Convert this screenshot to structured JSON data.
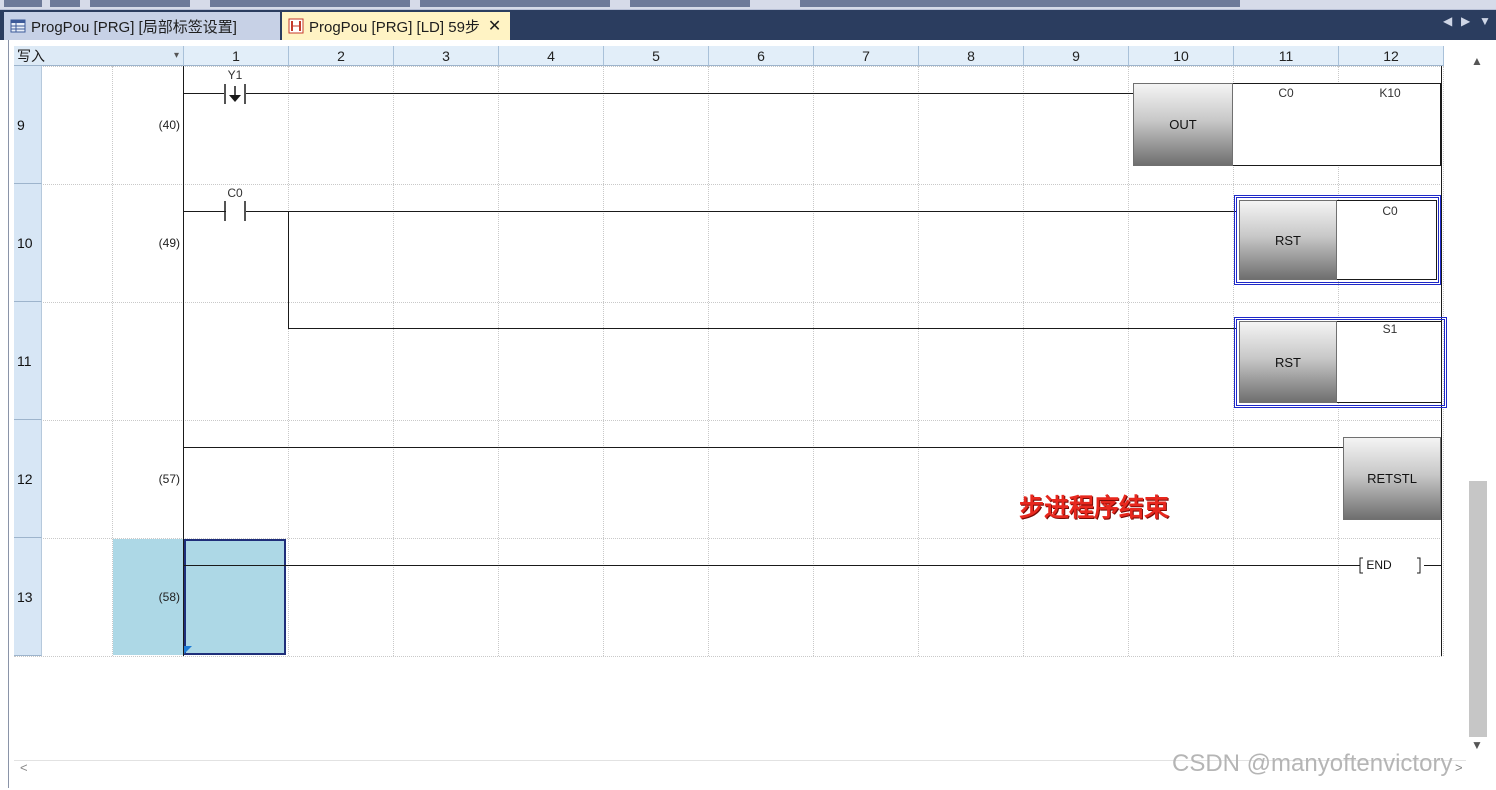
{
  "tabs": [
    {
      "label": "ProgPou [PRG] [局部标签设置]",
      "active": false,
      "icon": "label-table-icon"
    },
    {
      "label": "ProgPou [PRG] [LD] 59步",
      "active": true,
      "icon": "ladder-icon",
      "close": "✕"
    }
  ],
  "tab_nav": {
    "prev": "◀",
    "next": "▶",
    "dropdown": "▼"
  },
  "editor": {
    "mode": "写入",
    "mode_arrow": "▾",
    "columns": [
      "1",
      "2",
      "3",
      "4",
      "5",
      "6",
      "7",
      "8",
      "9",
      "10",
      "11",
      "12"
    ],
    "rows": [
      {
        "line": "9",
        "step": "(40)"
      },
      {
        "line": "10",
        "step": "(49)"
      },
      {
        "line": "11",
        "step": ""
      },
      {
        "line": "12",
        "step": "(57)"
      },
      {
        "line": "13",
        "step": "(58)"
      }
    ],
    "elements": {
      "y1_contact": "Y1",
      "c0_contact": "C0",
      "out_instr": "OUT",
      "out_device": "C0",
      "out_const": "K10",
      "rst1_instr": "RST",
      "rst1_device": "C0",
      "rst2_instr": "RST",
      "rst2_device": "S1",
      "retstl_instr": "RETSTL",
      "end_instr": "END"
    },
    "annotation": "步进程序结束"
  },
  "scroll": {
    "up": "▲",
    "down": "▼",
    "left": "<",
    "right": ">"
  },
  "watermark": "CSDN @manyoftenvictory",
  "colors": {
    "tab_bar": "#2b3d5f",
    "active_tab": "#fff3c4",
    "selection": "#add8e6",
    "annotation": "#e8281e",
    "highlight_frame": "#1e28c8"
  }
}
